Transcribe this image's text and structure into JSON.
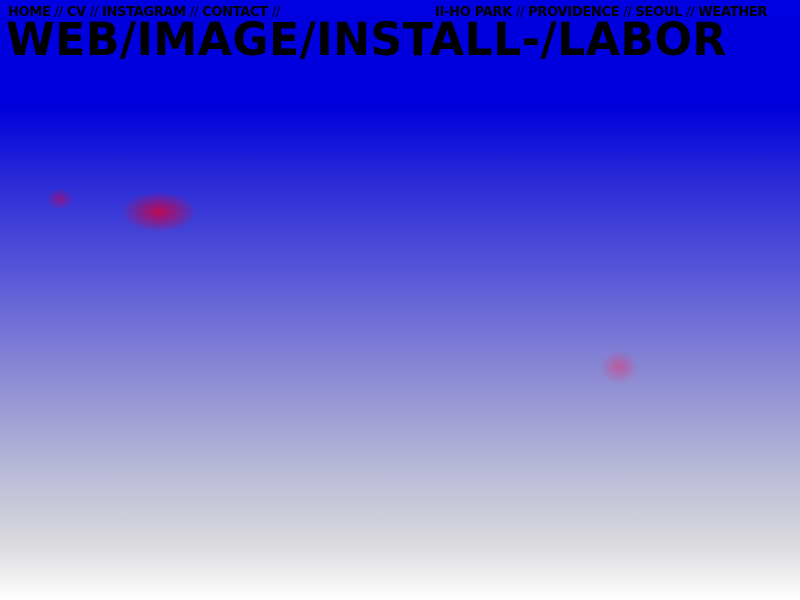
{
  "nav": {
    "left": [
      "HOME",
      "CV",
      "INSTAGRAM",
      "CONTACT"
    ],
    "right": [
      "II-HO PARK",
      "PROVIDENCE",
      "SEOUL",
      "WEATHER"
    ],
    "separator": "//"
  },
  "title": "WEB/IMAGE/INSTALL-/LABOR",
  "colors": {
    "top": "#0000e0",
    "bottom": "#ffffff",
    "blob": "#d2003c",
    "text": "#000000"
  }
}
